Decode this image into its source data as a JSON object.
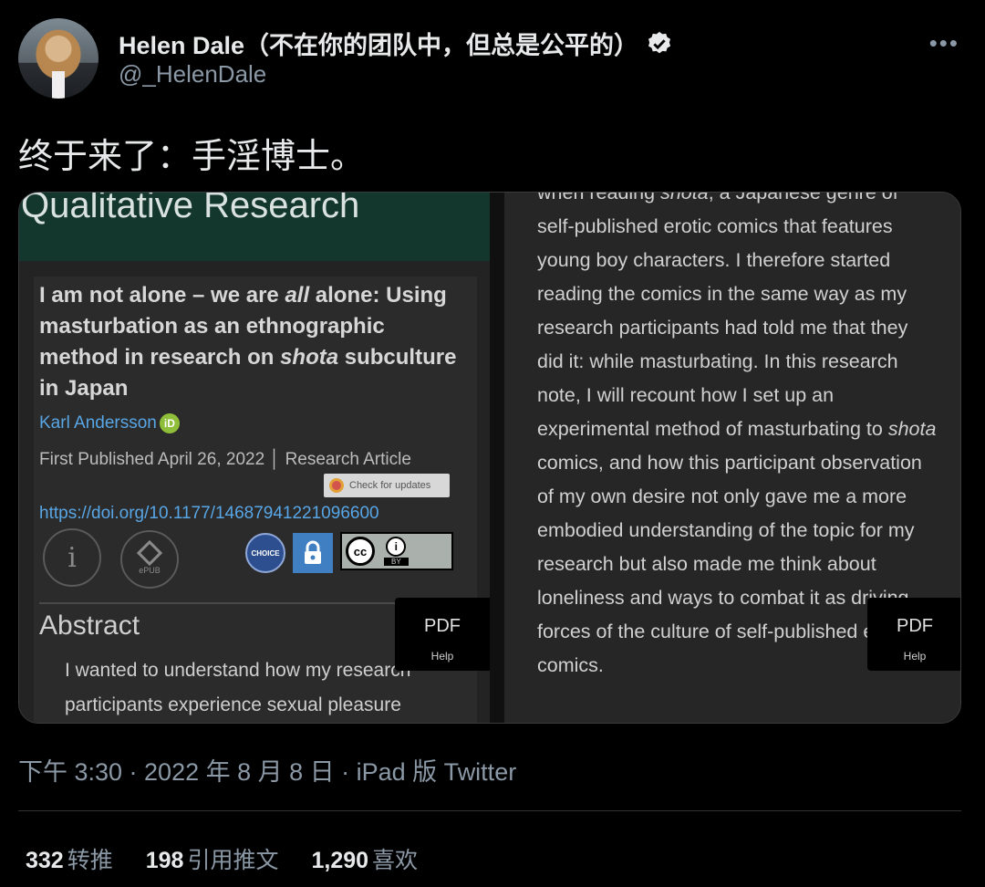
{
  "author": {
    "display_name": "Helen Dale（不在你的团队中，但总是公平的）",
    "handle": "@_HelenDale",
    "avatar_icon": "avatar",
    "verified_icon": "verified-badge-icon"
  },
  "tweet": {
    "text": "终于来了：手淫博士。",
    "timestamp": "下午 3:30 · 2022 年 8 月 8 日 · iPad 版 Twitter"
  },
  "media": {
    "left": {
      "journal_title": "Qualitative Research",
      "article_title_html_parts": [
        "I am not alone – we are ",
        "all",
        " alone: Using masturbation as an ethnographic method in research on ",
        "shota",
        " subculture in Japan"
      ],
      "author_name": "Karl Andersson",
      "orcid_label": "iD",
      "pub_line": "First Published April 26, 2022  │  Research Article",
      "check_updates": "Check for updates",
      "doi": "https://doi.org/10.1177/14687941221096600",
      "info_glyph": "i",
      "epub_label": "ePUB",
      "choice_label": "CHOICE",
      "cc_label": "cc",
      "by_label": "BY",
      "abstract_head": "Abstract",
      "abstract_text": "I wanted to understand how my research participants experience sexual pleasure",
      "pdf_label": "PDF",
      "help_label": "Help"
    },
    "right": {
      "text_parts": [
        "when reading ",
        "shota",
        ", a Japanese genre of self-published erotic comics that features young boy characters. I therefore started reading the comics in the same way as my research participants had told me that they did it: while masturbating. In this research note, I will recount how I set up an experimental method of masturbating to ",
        "shota",
        " comics, and how this participant observation of my own desire not only gave me a more embodied understanding of the topic for my research but also made me think about loneliness and ways to combat it as driving forces of the culture of self-published erotic comics."
      ],
      "pdf_label": "PDF",
      "help_label": "Help"
    }
  },
  "stats": {
    "retweets_count": "332",
    "retweets_label": "转推",
    "quotes_count": "198",
    "quotes_label": "引用推文",
    "likes_count": "1,290",
    "likes_label": "喜欢"
  },
  "colors": {
    "background": "#000000",
    "text_primary": "#e7e9ea",
    "text_secondary": "#8b98a5",
    "journal_banner": "#13372d",
    "link": "#58a6e6"
  },
  "more_icon": "more-horizontal-icon"
}
